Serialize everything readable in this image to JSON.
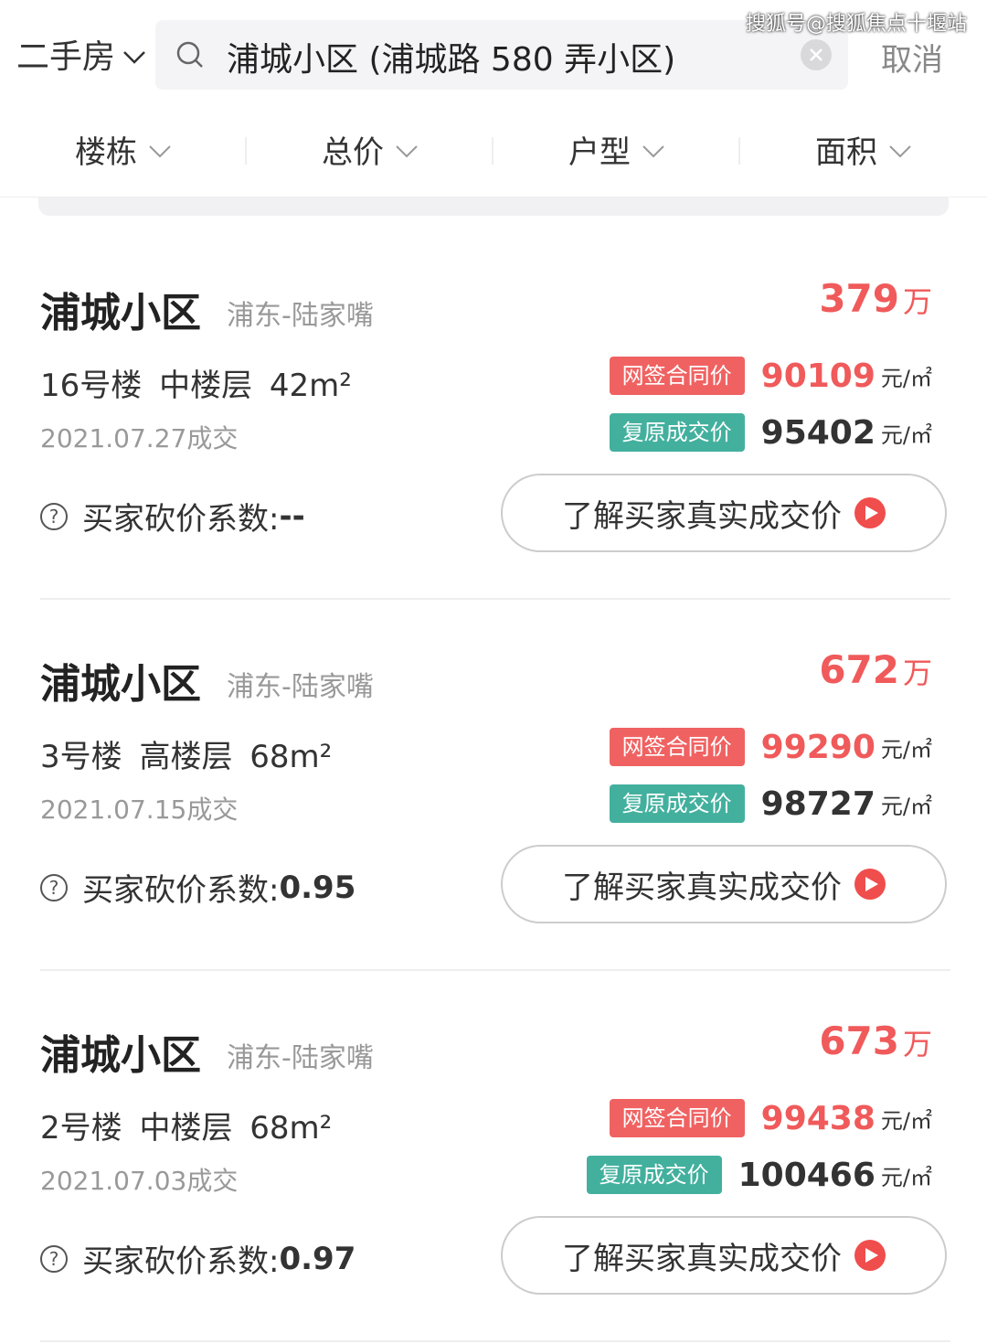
{
  "header": {
    "city_label": "二手房",
    "search_value": "浦城小区 (浦城路 580 弄小区)",
    "cancel_label": "取消",
    "watermark": "搜狐号@搜狐焦点十堰站"
  },
  "filters": [
    {
      "label": "楼栋"
    },
    {
      "label": "总价"
    },
    {
      "label": "户型"
    },
    {
      "label": "面积"
    }
  ],
  "labels": {
    "contract_tag": "网签合同价",
    "restored_tag": "复原成交价",
    "price_unit": "元/㎡",
    "total_unit": "万",
    "coef_label": "买家砍价系数:",
    "cta_label": "了解买家真实成交价",
    "area_unit": "m²"
  },
  "listings": [
    {
      "name": "浦城小区",
      "district": "浦东-陆家嘴",
      "total_price": "379",
      "info": "16号楼 中楼层 42m²",
      "date": "2021.07.27成交",
      "contract_price": "90109",
      "restored_price": "95402",
      "coef": "--"
    },
    {
      "name": "浦城小区",
      "district": "浦东-陆家嘴",
      "total_price": "672",
      "info": "3号楼 高楼层 68m²",
      "date": "2021.07.15成交",
      "contract_price": "99290",
      "restored_price": "98727",
      "coef": "0.95"
    },
    {
      "name": "浦城小区",
      "district": "浦东-陆家嘴",
      "total_price": "673",
      "info": "2号楼 中楼层 68m²",
      "date": "2021.07.03成交",
      "contract_price": "99438",
      "restored_price": "100466",
      "coef": "0.97"
    }
  ],
  "colors": {
    "accent_red": "#f05a5a",
    "tag_teal": "#43b09e"
  }
}
